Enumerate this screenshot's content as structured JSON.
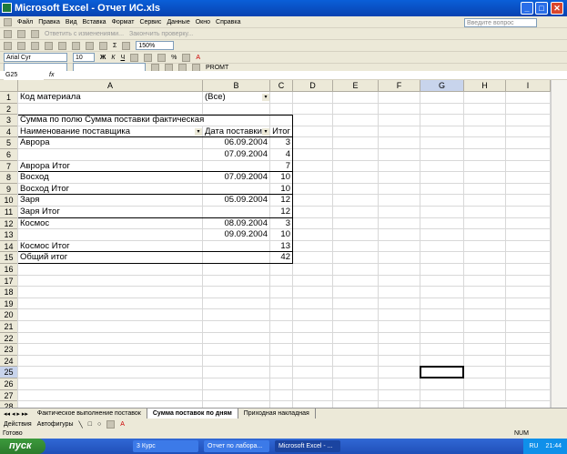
{
  "window": {
    "title": "Microsoft Excel - Отчет ИС.xls"
  },
  "menu": [
    "Файл",
    "Правка",
    "Вид",
    "Вставка",
    "Формат",
    "Сервис",
    "Данные",
    "Окно",
    "Справка"
  ],
  "help_placeholder": "Введите вопрос",
  "review_toolbar": {
    "reply": "Ответить с изменениями...",
    "end": "Закончить проверку..."
  },
  "standard_toolbar": {
    "zoom": "150%"
  },
  "format_toolbar": {
    "font": "Arial Cyr",
    "size": "10"
  },
  "promt_label": "PROMT",
  "formula_bar": {
    "name_box": "G25",
    "fx": "fx",
    "value": ""
  },
  "columns": [
    "A",
    "B",
    "C",
    "D",
    "E",
    "F",
    "G",
    "H",
    "I"
  ],
  "rows": [
    {
      "n": "1",
      "A": "Код материала",
      "B": "(Все)",
      "C": ""
    },
    {
      "n": "2",
      "A": "",
      "B": "",
      "C": ""
    },
    {
      "n": "3",
      "A": "Сумма по полю Сумма поставки фактическая",
      "B": "",
      "C": ""
    },
    {
      "n": "4",
      "A": "Наименование поставщика",
      "B": "Дата поставки",
      "C": "Итог"
    },
    {
      "n": "5",
      "A": "Аврора",
      "B": "06.09.2004",
      "C": "3"
    },
    {
      "n": "6",
      "A": "",
      "B": "07.09.2004",
      "C": "4"
    },
    {
      "n": "7",
      "A": "Аврора  Итог",
      "B": "",
      "C": "7"
    },
    {
      "n": "8",
      "A": "Восход",
      "B": "07.09.2004",
      "C": "10"
    },
    {
      "n": "9",
      "A": "Восход Итог",
      "B": "",
      "C": "10"
    },
    {
      "n": "10",
      "A": "Заря",
      "B": "05.09.2004",
      "C": "12"
    },
    {
      "n": "11",
      "A": "Заря Итог",
      "B": "",
      "C": "12"
    },
    {
      "n": "12",
      "A": "Космос",
      "B": "08.09.2004",
      "C": "3"
    },
    {
      "n": "13",
      "A": "",
      "B": "09.09.2004",
      "C": "10"
    },
    {
      "n": "14",
      "A": "Космос Итог",
      "B": "",
      "C": "13"
    },
    {
      "n": "15",
      "A": "Общий итог",
      "B": "",
      "C": "42"
    },
    {
      "n": "16"
    },
    {
      "n": "17"
    },
    {
      "n": "18"
    },
    {
      "n": "19"
    },
    {
      "n": "20"
    },
    {
      "n": "21"
    },
    {
      "n": "22"
    },
    {
      "n": "23"
    },
    {
      "n": "24"
    },
    {
      "n": "25"
    },
    {
      "n": "26"
    },
    {
      "n": "27"
    },
    {
      "n": "28"
    }
  ],
  "sheet_tabs": [
    {
      "label": "Фактическое выполнение поставок",
      "active": false
    },
    {
      "label": "Сумма поставок по дням",
      "active": true
    },
    {
      "label": "Приходная накладная",
      "active": false
    }
  ],
  "drawing_toolbar": {
    "actions": "Действия",
    "autoshapes": "Автофигуры"
  },
  "status": {
    "left": "Готово",
    "right": "NUM"
  },
  "taskbar": {
    "start": "пуск",
    "items": [
      "3 Курс",
      "Отчет по лабора...",
      "Microsoft Excel - ..."
    ],
    "lang": "RU",
    "clock": "21:44"
  }
}
